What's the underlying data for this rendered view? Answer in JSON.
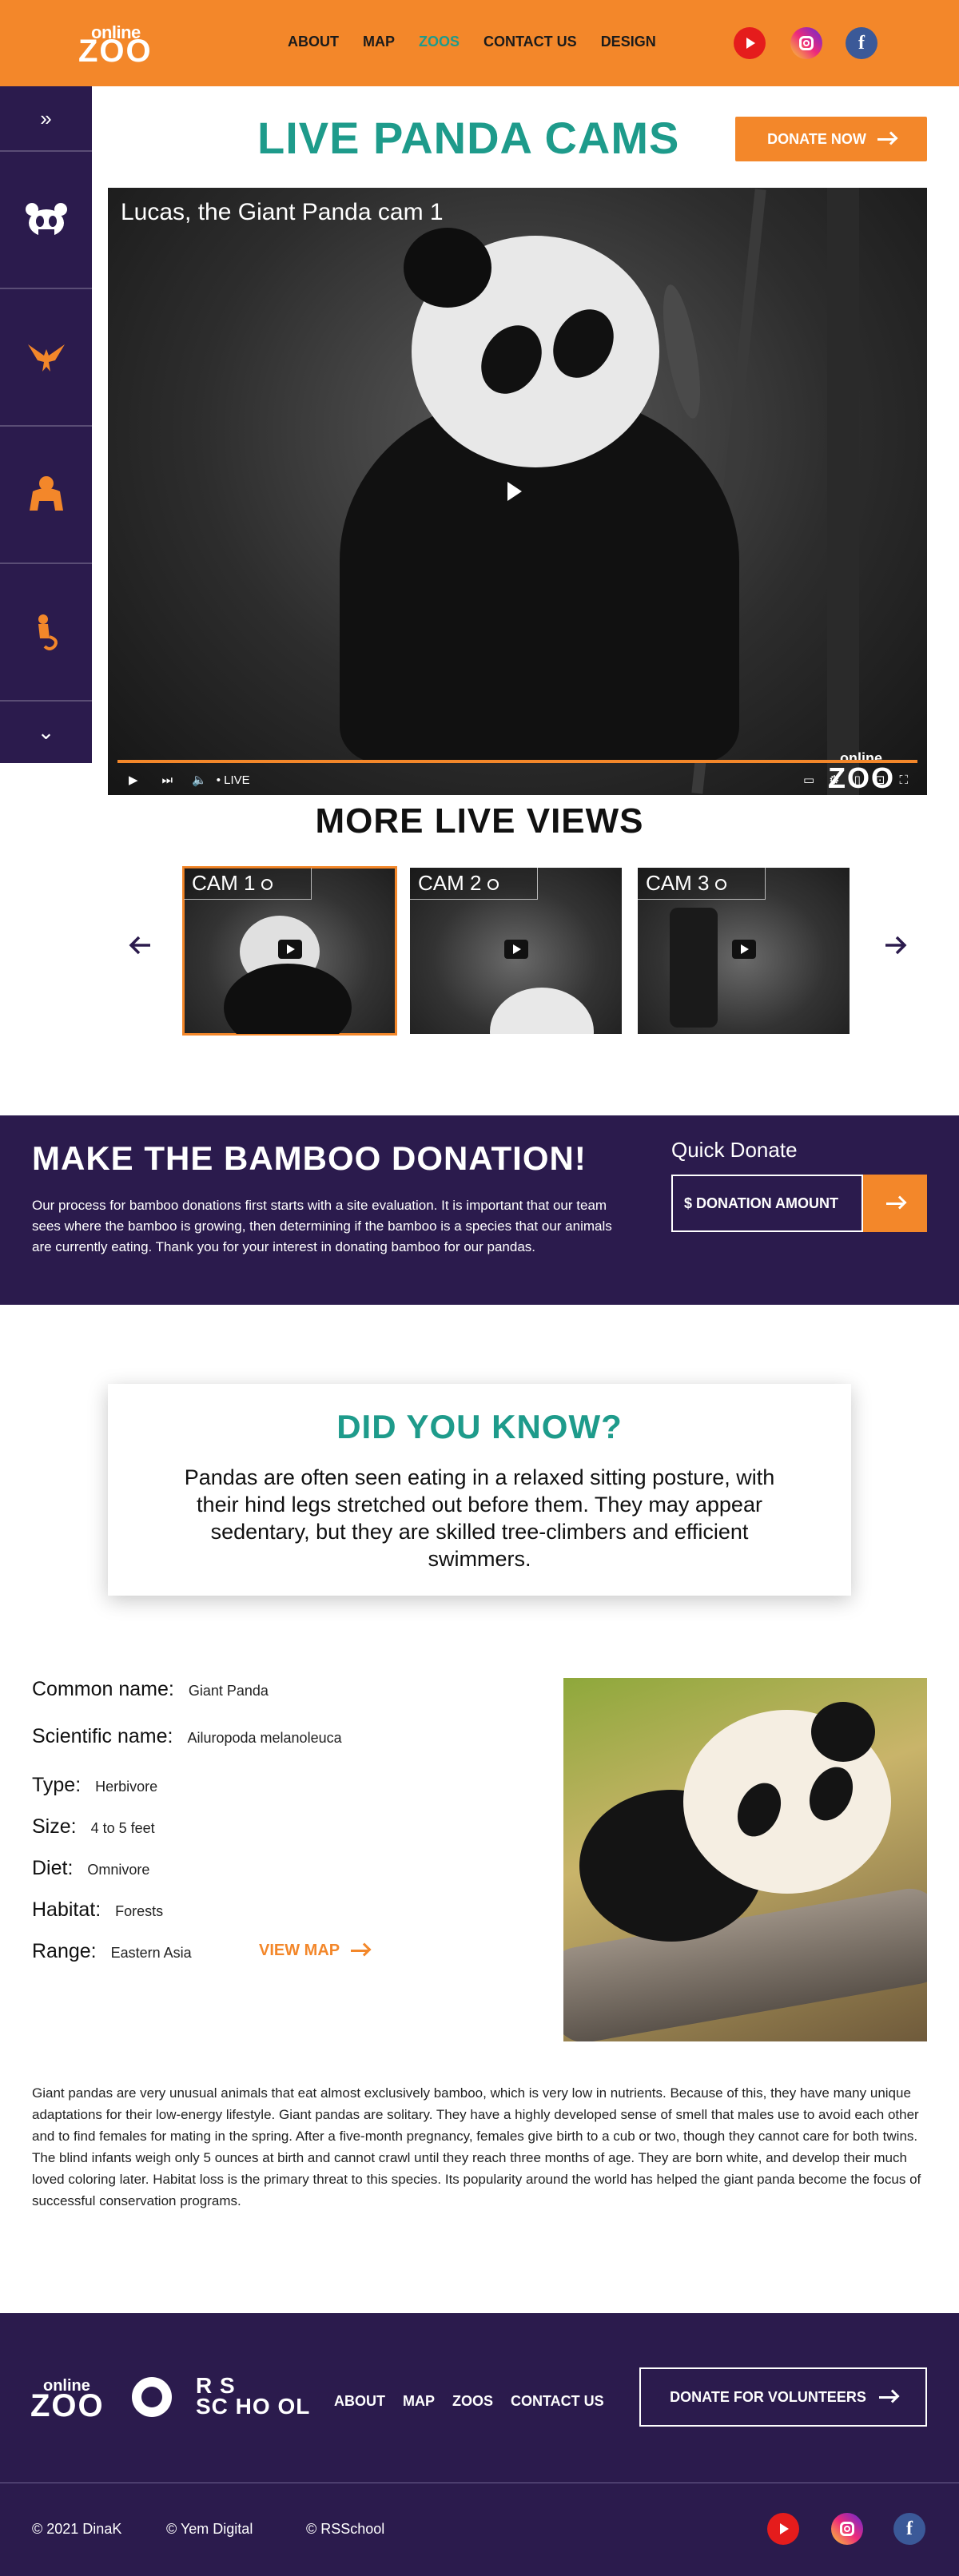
{
  "header": {
    "logo_top": "online",
    "logo_bottom": "ZOO",
    "nav": [
      "ABOUT",
      "MAP",
      "ZOOS",
      "CONTACT US",
      "DESIGN"
    ],
    "active_nav": "ZOOS",
    "social": [
      "youtube-icon",
      "instagram-icon",
      "facebook-icon"
    ]
  },
  "sidebar": {
    "items": [
      "expand-icon",
      "panda-icon",
      "eagle-icon",
      "gorilla-icon",
      "lemur-icon",
      "chevron-down-icon"
    ]
  },
  "live": {
    "title": "LIVE PANDA CAMS",
    "donate_label": "DONATE NOW",
    "video_title": "Lucas, the Giant Panda cam 1",
    "live_label": "• LIVE",
    "watermark_top": "online",
    "watermark_bottom": "ZOO"
  },
  "more": {
    "title": "MORE LIVE VIEWS",
    "cams": [
      "CAM 1",
      "CAM 2",
      "CAM 3"
    ],
    "active_cam": 0
  },
  "donation": {
    "title": "MAKE THE BAMBOO DONATION!",
    "text": "Our process for bamboo donations first starts with a site evaluation. It is important that our team sees where the bamboo is growing, then determining if the bamboo is a species that our animals are currently eating. Thank you for your interest in donating bamboo for our pandas.",
    "quick_label": "Quick Donate",
    "amount_placeholder": "$ DONATION AMOUNT"
  },
  "did_you_know": {
    "title": "DID YOU KNOW?",
    "text": "Pandas are often seen eating in a relaxed sitting posture, with their hind legs stretched out before them. They may appear sedentary, but they are skilled tree-climbers and efficient swimmers."
  },
  "facts": {
    "common_name_label": "Common name:",
    "common_name": "Giant Panda",
    "scientific_label": "Scientific name:",
    "scientific": "Ailuropoda melanoleuca",
    "type_label": "Type:",
    "type": "Herbivore",
    "size_label": "Size:",
    "size": "4 to 5 feet",
    "diet_label": "Diet:",
    "diet": "Omnivore",
    "habitat_label": "Habitat:",
    "habitat": "Forests",
    "range_label": "Range:",
    "range": "Eastern Asia",
    "view_map": "VIEW MAP"
  },
  "description": "Giant pandas are very unusual animals that eat almost exclusively bamboo, which is very low in nutrients. Because of this, they have many unique adaptations for their low-energy lifestyle. Giant pandas are solitary. They have a highly developed sense of smell that males use to avoid each other and to find females for mating in the spring. After a five-month pregnancy, females give birth to a cub or two, though they cannot care for both twins. The blind infants weigh only 5 ounces at birth and cannot crawl until they reach three months of age. They are born white, and develop their much loved coloring later. Habitat loss is the primary threat to this species. Its popularity around the world has helped the giant panda become the focus of successful conservation programs.",
  "footer": {
    "logo_top": "online",
    "logo_bottom": "ZOO",
    "rss_top": "R S",
    "rss_bottom": "SC HO OL",
    "nav": [
      "ABOUT",
      "MAP",
      "ZOOS",
      "CONTACT US"
    ],
    "volunteer_label": "DONATE FOR VOLUNTEERS",
    "copyright": [
      "© 2021 DinaK",
      "© Yem Digital",
      "© RSSchool"
    ]
  },
  "colors": {
    "accent": "#f3872a",
    "teal": "#1e9b8b",
    "dark": "#2b1b4d"
  }
}
